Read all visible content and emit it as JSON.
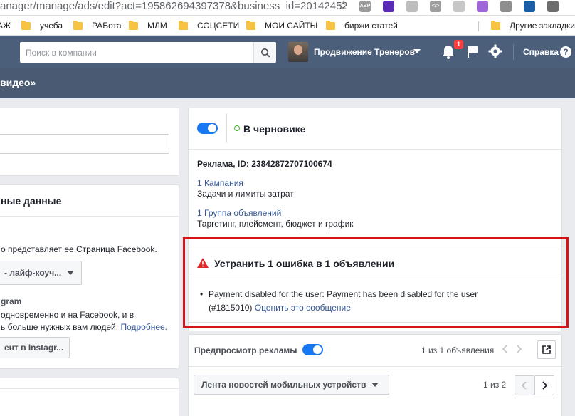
{
  "browser": {
    "url": "anager/manage/ads/edit?act=195862694397378&business_id=20142452",
    "extensions": [
      {
        "name": "abp-icon",
        "label": "ABP",
        "color": "#9b9b9b"
      },
      {
        "name": "layers-icon",
        "label": "",
        "color": "#5b2bb5"
      },
      {
        "name": "camera-icon",
        "label": "",
        "color": "#bdbdbd"
      },
      {
        "name": "code-icon",
        "label": "</>",
        "color": "#9e9e9e"
      },
      {
        "name": "globe-icon",
        "label": "",
        "color": "#c7c7c7"
      },
      {
        "name": "feather-icon",
        "label": "",
        "color": "#a065d8"
      },
      {
        "name": "page-icon",
        "label": "",
        "color": "#8e8e8e"
      },
      {
        "name": "save-icon",
        "label": "",
        "color": "#1a5ea8"
      },
      {
        "name": "puzzle-icon",
        "label": "",
        "color": "#6d6d6d"
      }
    ],
    "bookmarks": [
      "АЖ",
      "учеба",
      "РАБота",
      "МЛМ",
      "СОЦСЕТИ",
      "МОИ САЙТЫ",
      "биржи статей",
      "Другие закладки"
    ]
  },
  "topbar": {
    "search_placeholder": "Поиск в компании",
    "account_name": "Продвижение Тренеров",
    "notifications_count": "1",
    "help_label": "Справка"
  },
  "campaign": {
    "title_fragment": "видео»"
  },
  "left": {
    "section_title": "ные данные",
    "page_represents": "о представляет ее Страница Facebook.",
    "page_select": "- лайф-коуч...",
    "instagram_title": "gram",
    "instagram_line1": "одновременно и на Facebook, и в",
    "instagram_line2_prefix": "ь больше нужных вам людей.",
    "instagram_more_link": "Подробнее.",
    "instagram_button": "ент в Instagr..."
  },
  "ad": {
    "status": "В черновике",
    "ad_id_label": "Реклама, ID: 23842872707100674",
    "campaign_link": "1 Кампания",
    "campaign_desc": "Задачи и лимиты затрат",
    "adset_link": "1 Группа объявлений",
    "adset_desc": "Таргетинг, плейсмент, бюджет и график"
  },
  "error": {
    "title": "Устранить 1 ошибка в 1 объявлении",
    "message_line1": "Payment disabled for the user: Payment has been disabled for the user",
    "message_line2_prefix": "(#1815010)",
    "rate_link": "Оценить это сообщение"
  },
  "preview": {
    "label": "Предпросмотр рекламы",
    "count_text": "1 из 1 объявления",
    "placement_select": "Лента новостей мобильных устройств",
    "page_text": "1 из 2"
  }
}
